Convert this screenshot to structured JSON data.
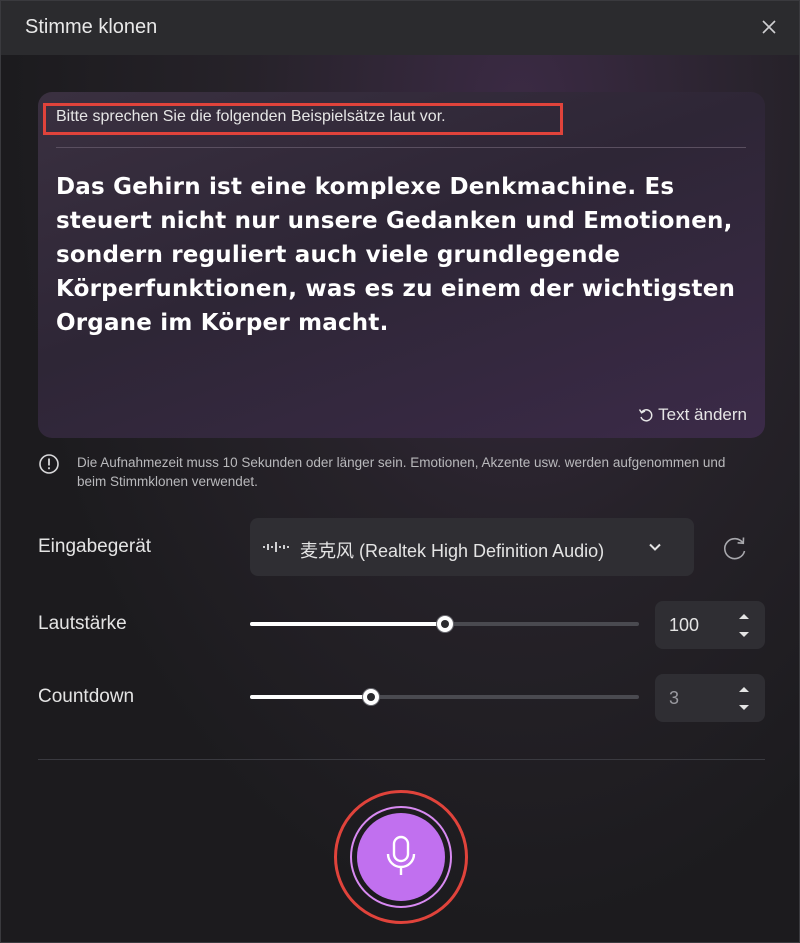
{
  "dialog": {
    "title": "Stimme klonen"
  },
  "card": {
    "instruction": "Bitte sprechen Sie die folgenden Beispielsätze laut vor.",
    "sample_text": "Das Gehirn ist eine komplexe Denkmachine. Es steuert nicht nur unsere Gedanken und Emotionen, sondern reguliert auch viele grundlegende Körperfunktionen, was es zu einem der wichtigsten Organe im Körper macht.",
    "change_text_label": "Text ändern"
  },
  "notice": {
    "text": "Die Aufnahmezeit muss 10 Sekunden oder länger sein. Emotionen, Akzente usw. werden aufgenommen und beim Stimmklonen verwendet."
  },
  "input_device": {
    "label": "Eingabegerät",
    "selected": "麦克风 (Realtek High Definition Audio)"
  },
  "volume": {
    "label": "Lautstärke",
    "value": "100",
    "slider_fraction": 0.5
  },
  "countdown": {
    "label": "Countdown",
    "value": "3",
    "slider_fraction": 0.31
  },
  "colors": {
    "accent": "#c170ef",
    "highlight_border": "#e0433b"
  },
  "icons": {
    "close": "close-icon",
    "change_text": "undo-icon",
    "notice": "info-icon",
    "device": "waveform-icon",
    "dropdown": "chevron-down-icon",
    "refresh": "refresh-icon",
    "record": "microphone-icon"
  }
}
